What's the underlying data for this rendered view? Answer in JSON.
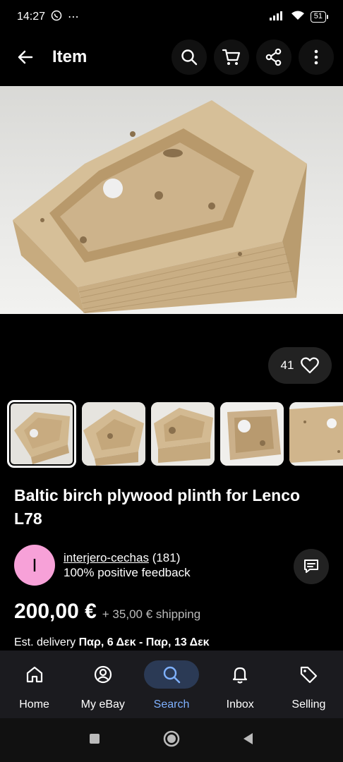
{
  "status": {
    "time": "14:27",
    "battery": "51"
  },
  "app_bar": {
    "title": "Item"
  },
  "likes": {
    "count": "41"
  },
  "item": {
    "title": "Baltic birch plywood plinth for Lenco L78"
  },
  "seller": {
    "initial": "I",
    "name": "interjero-cechas",
    "rating_count": "(181)",
    "feedback": "100% positive feedback"
  },
  "price": {
    "amount": "200,00 €",
    "shipping": "+ 35,00 € shipping"
  },
  "delivery": {
    "prefix": "Est. delivery",
    "range": "Παρ, 6 Δεκ - Παρ, 13 Δεκ"
  },
  "bottom_nav": {
    "items": [
      {
        "label": "Home",
        "icon": "home-icon"
      },
      {
        "label": "My eBay",
        "icon": "profile-icon"
      },
      {
        "label": "Search",
        "icon": "search-icon"
      },
      {
        "label": "Inbox",
        "icon": "bell-icon"
      },
      {
        "label": "Selling",
        "icon": "tag-icon"
      }
    ],
    "active": "Search"
  },
  "colors": {
    "accent": "#7fb1ff",
    "avatar": "#f7a1d8",
    "nav_bg": "#1b1b1f"
  }
}
